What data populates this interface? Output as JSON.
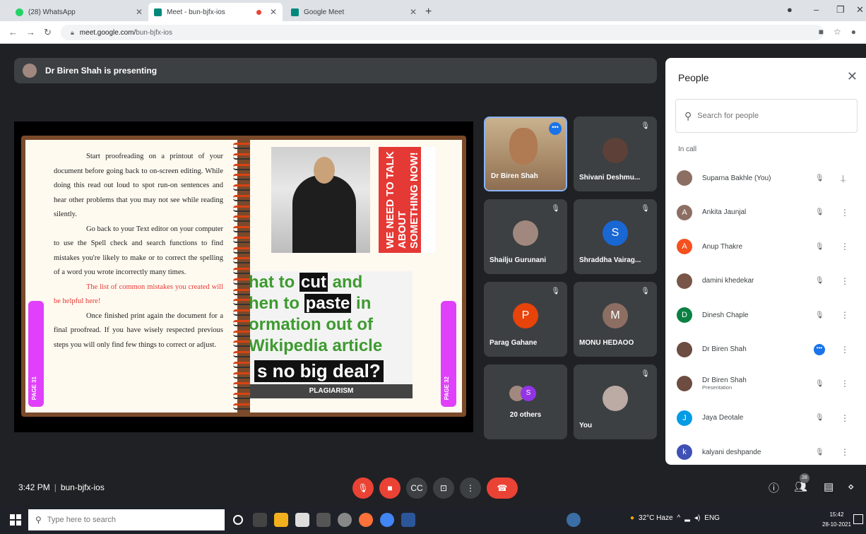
{
  "browser": {
    "tabs": [
      {
        "label": "(28) WhatsApp",
        "favicon_color": "#25d366"
      },
      {
        "label": "Meet - bun-bjfx-ios",
        "favicon_color": "#00897b"
      },
      {
        "label": "Google Meet",
        "favicon_color": "#00897b"
      }
    ],
    "new_tab": "+",
    "url_host": "meet.google.com/",
    "url_path": "bun-bjfx-ios"
  },
  "meet": {
    "presenting_text": "Dr Biren Shah is presenting",
    "slide": {
      "left_page_tab": "PAGE 31",
      "right_page_tab": "PAGE 32",
      "paragraphs": [
        {
          "text": "Start proofreading on a printout of your document before going back to on-screen editing. While doing this read out loud to spot run-on sentences and hear other problems that you may not see while reading silently.",
          "red": false
        },
        {
          "text": "Go back to your Text editor on your computer to use the Spell check and search functions to find mistakes you're likely to make or to correct the spelling of a word you wrote incorrectly many times.",
          "red": false
        },
        {
          "text": "The list of common mistakes you created will be helpful here!",
          "red": true
        },
        {
          "text": "Once finished print again the document for a final proofread. If you have wisely respected previous steps you will only find few things to correct or adjust.",
          "red": false
        }
      ],
      "poster_text": "WE NEED TO TALK ABOUT SOMETHING NOW!",
      "plag_lines": {
        "l1a": "hat to ",
        "l1b": "cut",
        "l1c": " and",
        "l2a": "hen to ",
        "l2b": "paste",
        "l2c": " in",
        "l3": "ormation out of",
        "l4": "Wikipedia article",
        "l5": "s no big deal?"
      },
      "plag_label": "PLAGIARISM"
    },
    "tiles": [
      {
        "name": "Dr Biren Shah"
      },
      {
        "name": "Shivani Deshmu..."
      },
      {
        "name": "Shailju Gurunani"
      },
      {
        "name": "Shraddha Vairag...",
        "initial": "S",
        "color": "#1967d2"
      },
      {
        "name": "Parag Gahane",
        "initial": "P",
        "color": "#e8430a"
      },
      {
        "name": "MONU HEDAOO",
        "initial": "M",
        "color": "#8d6e63"
      },
      {
        "name": "20 others",
        "initial": "S",
        "color": "#9334e6"
      },
      {
        "name": "You"
      }
    ],
    "clock": "3:42 PM",
    "meeting_code": "bun-bjfx-ios",
    "people_count": "28"
  },
  "people": {
    "title": "People",
    "search_placeholder": "Search for people",
    "section": "In call",
    "list": [
      {
        "name": "Suparna Bakhle (You)",
        "sub": "",
        "avatar": "",
        "color": "#8d6e63"
      },
      {
        "name": "Ankita Jaunjal",
        "sub": "",
        "avatar": "A",
        "color": "#8d6e63"
      },
      {
        "name": "Anup Thakre",
        "sub": "",
        "avatar": "A",
        "color": "#f4511e"
      },
      {
        "name": "damini khedekar",
        "sub": "",
        "avatar": "",
        "color": "#795548"
      },
      {
        "name": "Dinesh Chaple",
        "sub": "",
        "avatar": "D",
        "color": "#0b8043"
      },
      {
        "name": "Dr Biren Shah",
        "sub": "",
        "avatar": "",
        "color": "#6d4c41"
      },
      {
        "name": "Dr Biren Shah",
        "sub": "Presentation",
        "avatar": "",
        "color": "#6d4c41"
      },
      {
        "name": "Jaya Deotale",
        "sub": "",
        "avatar": "J",
        "color": "#039be5"
      },
      {
        "name": "kalyani deshpande",
        "sub": "",
        "avatar": "k",
        "color": "#3f51b5"
      }
    ]
  },
  "taskbar": {
    "search_placeholder": "Type here to search",
    "weather": "32°C Haze",
    "lang": "ENG",
    "time": "15:42",
    "date": "28-10-2021"
  }
}
